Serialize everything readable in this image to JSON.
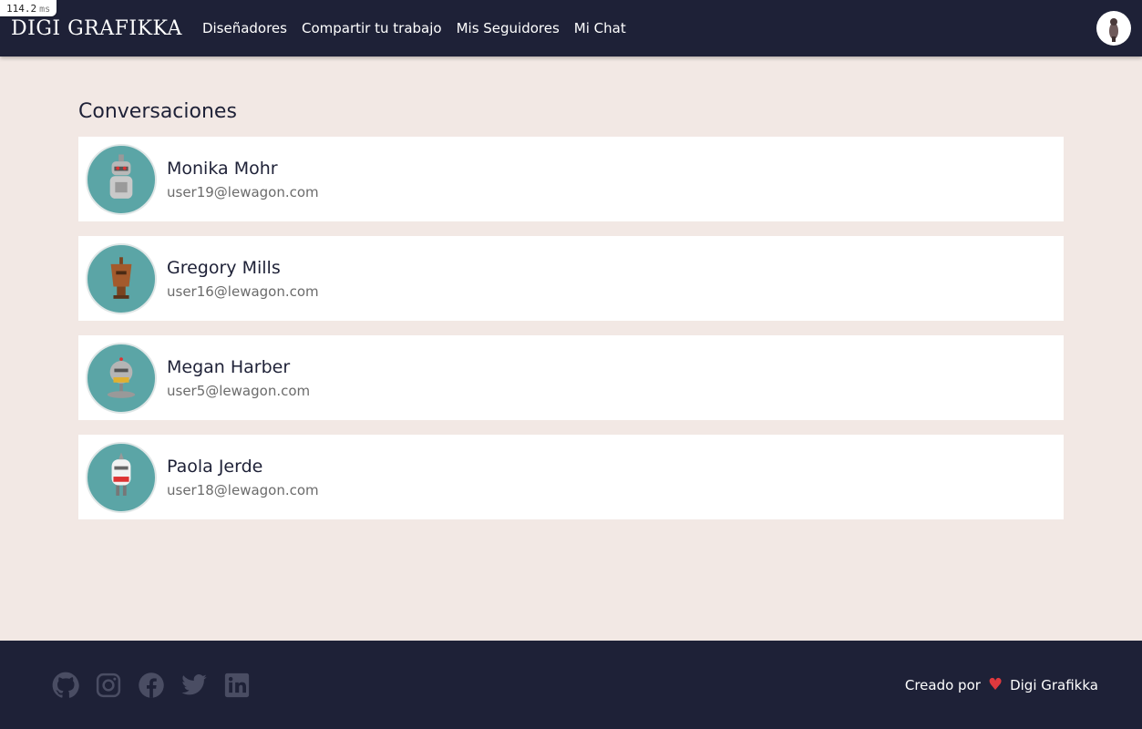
{
  "perf": {
    "value": "114.2",
    "unit": "ms"
  },
  "navbar": {
    "brand": "DIGI GRAFIKKA",
    "links": [
      {
        "label": "Diseñadores"
      },
      {
        "label": "Compartir tu trabajo"
      },
      {
        "label": "Mis Seguidores"
      },
      {
        "label": "Mi Chat"
      }
    ]
  },
  "main": {
    "title": "Conversaciones",
    "conversations": [
      {
        "name": "Monika Mohr",
        "email": "user19@lewagon.com",
        "avatar": "robot-avatar-gray"
      },
      {
        "name": "Gregory Mills",
        "email": "user16@lewagon.com",
        "avatar": "robot-avatar-brown"
      },
      {
        "name": "Megan Harber",
        "email": "user5@lewagon.com",
        "avatar": "robot-avatar-round"
      },
      {
        "name": "Paola Jerde",
        "email": "user18@lewagon.com",
        "avatar": "robot-avatar-white"
      }
    ]
  },
  "footer": {
    "social_icons": [
      "github-icon",
      "instagram-icon",
      "facebook-icon",
      "twitter-icon",
      "linkedin-icon"
    ],
    "credit_prefix": "Creado por",
    "credit_name": "Digi Grafikka"
  },
  "colors": {
    "navbar_bg": "#1e2137",
    "page_bg": "#f2e8e4",
    "avatar_bg": "#5ba5a6",
    "heart": "#e0393e"
  }
}
